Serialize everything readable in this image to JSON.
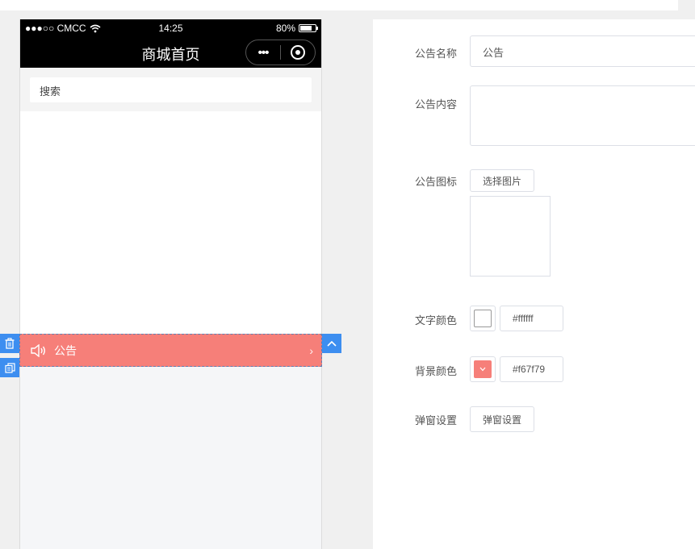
{
  "phone": {
    "status": {
      "carrier": "●●●○○ CMCC",
      "time": "14:25",
      "battery_text": "80%",
      "battery_level": 0.8
    },
    "nav_title": "商城首页",
    "capsule_dots": "•••",
    "search_placeholder": "搜索",
    "notice": {
      "text": "公告",
      "arrow": "›",
      "bg_color": "#f67f79"
    }
  },
  "panel": {
    "name_label": "公告名称",
    "name_value": "公告",
    "content_label": "公告内容",
    "content_value": "",
    "icon_label": "公告图标",
    "choose_image_button": "选择图片",
    "text_color_label": "文字颜色",
    "text_color_value": "#ffffff",
    "bg_color_label": "背景颜色",
    "bg_color_value": "#f67f79",
    "popup_label": "弹窗设置",
    "popup_button": "弹窗设置"
  }
}
